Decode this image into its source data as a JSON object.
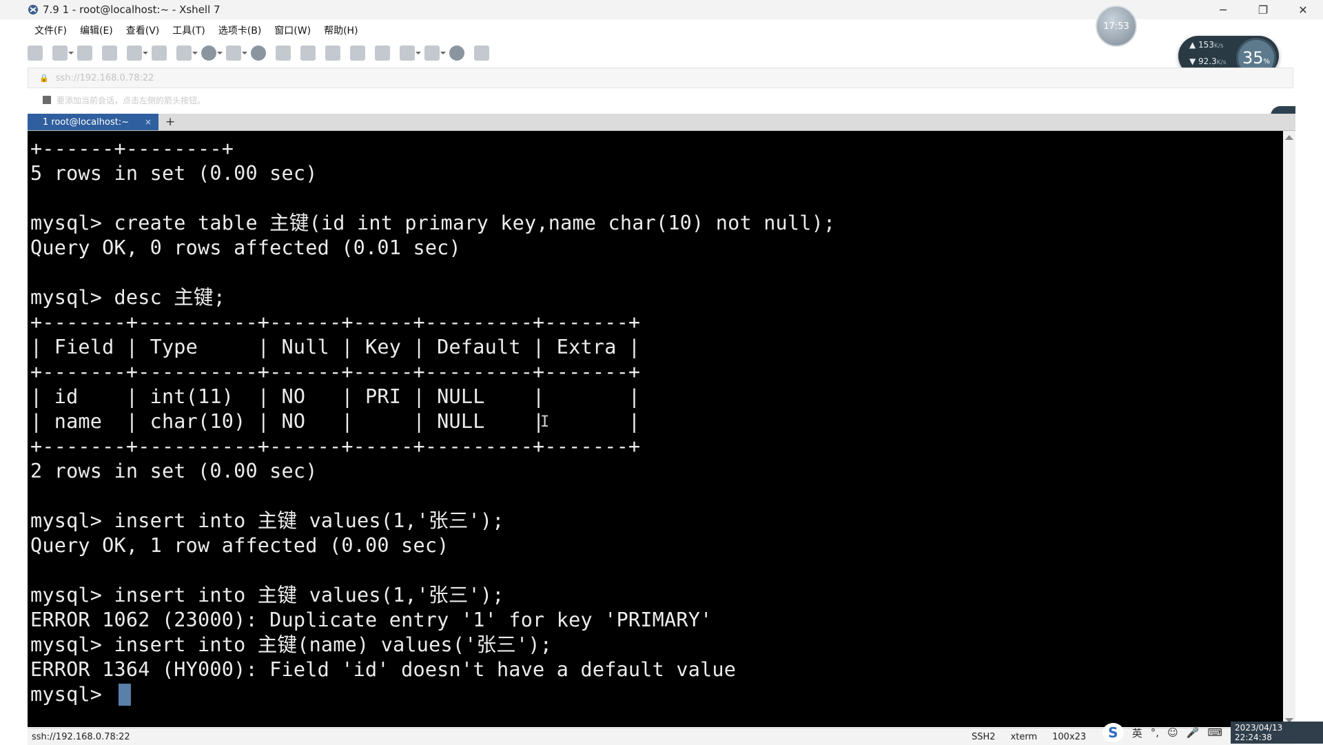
{
  "window": {
    "title": "7.9 1 - root@localhost:~ - Xshell 7",
    "controls": {
      "minimize": "─",
      "maximize": "❐",
      "close": "✕"
    }
  },
  "clock_avatar": "17:53",
  "menu": [
    "文件(F)",
    "编辑(E)",
    "查看(V)",
    "工具(T)",
    "选项卡(B)",
    "窗口(W)",
    "帮助(H)"
  ],
  "net_monitor": {
    "up": "153",
    "up_unit": "K/s",
    "down": "92.3",
    "down_unit": "K/s",
    "percent": "35",
    "percent_unit": "%"
  },
  "address_bar": {
    "value": "ssh://192.168.0.78:22"
  },
  "hint_bar": {
    "text": "要添加当前会话，点击左侧的箭头按钮。"
  },
  "tab": {
    "label": "1 root@localhost:~",
    "close": "×",
    "add": "+"
  },
  "terminal": {
    "lines": [
      "+------+--------+",
      "5 rows in set (0.00 sec)",
      "",
      "mysql> create table 主键(id int primary key,name char(10) not null);",
      "Query OK, 0 rows affected (0.01 sec)",
      "",
      "mysql> desc 主键;",
      "+-------+----------+------+-----+---------+-------+",
      "| Field | Type     | Null | Key | Default | Extra |",
      "+-------+----------+------+-----+---------+-------+",
      "| id    | int(11)  | NO   | PRI | NULL    |       |",
      "| name  | char(10) | NO   |     | NULL    |       |",
      "+-------+----------+------+-----+---------+-------+",
      "2 rows in set (0.00 sec)",
      "",
      "mysql> insert into 主键 values(1,'张三');",
      "Query OK, 1 row affected (0.00 sec)",
      "",
      "mysql> insert into 主键 values(1,'张三');",
      "ERROR 1062 (23000): Duplicate entry '1' for key 'PRIMARY'",
      "mysql> insert into 主键(name) values('张三');",
      "ERROR 1364 (HY000): Field 'id' doesn't have a default value",
      "mysql> "
    ]
  },
  "status_bar": {
    "address": "ssh://192.168.0.78:22",
    "protocol": "SSH2",
    "term": "xterm",
    "size": "100x23"
  },
  "tray": {
    "ime_lang": "英",
    "datetime": "2023/04/13 22:24:38"
  }
}
